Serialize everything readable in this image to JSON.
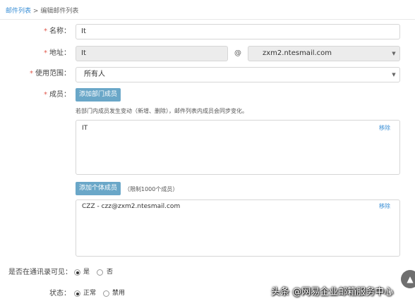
{
  "breadcrumb": {
    "parent": "邮件列表",
    "separator": ">",
    "current": "编辑邮件列表"
  },
  "form": {
    "required_mark": "*",
    "name": {
      "label": "名称：",
      "value": "It"
    },
    "address": {
      "label": "地址：",
      "local_value": "It",
      "at": "@",
      "domain": "zxm2.ntesmail.com"
    },
    "scope": {
      "label": "使用范围：",
      "value": "所有人"
    },
    "members": {
      "label": "成员：",
      "add_dept_button": "添加部门成员",
      "dept_hint": "若部门内成员发生变动（新增、删除），邮件列表内成员会同步变化。",
      "dept_list": [
        {
          "name": "IT",
          "remove": "移除"
        }
      ],
      "add_individual_button": "添加个体成员",
      "individual_hint": "（限制1000个成员）",
      "individual_list": [
        {
          "name": "CZZ - czz@zxm2.ntesmail.com",
          "remove": "移除"
        }
      ]
    },
    "visible": {
      "label": "是否在通讯录可见：",
      "options": [
        "是",
        "否"
      ],
      "selected": "是"
    },
    "status": {
      "label": "状态：",
      "options": [
        "正常",
        "禁用"
      ],
      "selected": "正常"
    }
  },
  "icons": {
    "caret": "caret-down-icon",
    "scroll_top": "arrow-up-icon"
  },
  "watermark": "头条 @网易企业邮箱服务中心",
  "colors": {
    "link": "#3a8fd6",
    "button": "#6aa7c8",
    "required": "#e05a4e"
  }
}
